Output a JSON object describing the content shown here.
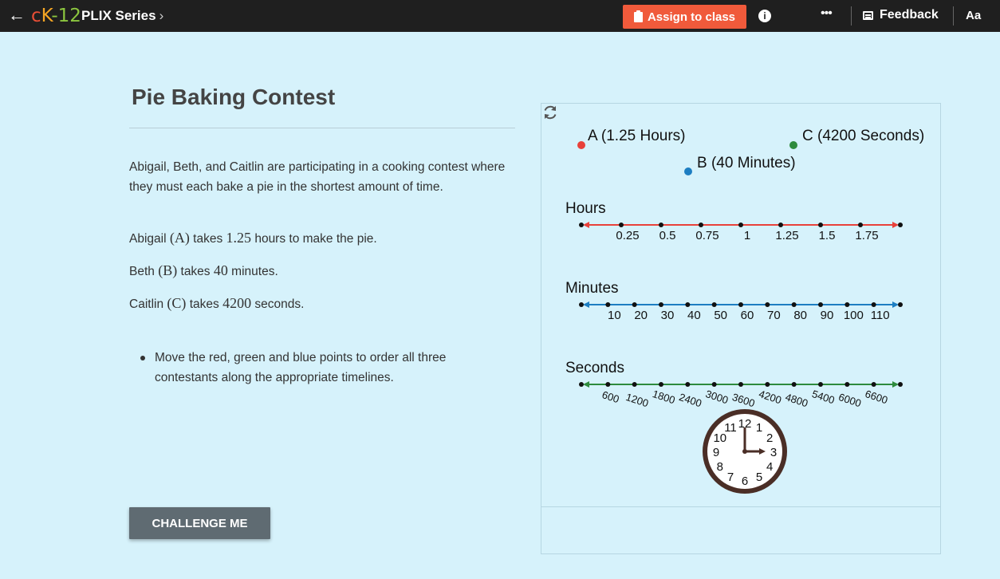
{
  "header": {
    "logo": {
      "c": "c",
      "k": "K",
      "dash": "-",
      "num": "12"
    },
    "series": "PLIX Series",
    "assign_label": "Assign to class",
    "info": "i",
    "more": "•••",
    "feedback_label": "Feedback",
    "font_size_label": "Aa"
  },
  "page": {
    "title": "Pie Baking Contest",
    "intro": "Abigail, Beth, and Caitlin are participating in a cooking contest where they must each bake a pie in the shortest amount of time.",
    "line_a": {
      "pre": "Abigail ",
      "sym": "(A)",
      "mid": " takes ",
      "num": "1.25",
      "post": " hours to make the pie."
    },
    "line_b": {
      "pre": "Beth ",
      "sym": "(B)",
      "mid": " takes ",
      "num": "40",
      "post": " minutes."
    },
    "line_c": {
      "pre": "Caitlin ",
      "sym": "(C)",
      "mid": " takes ",
      "num": "4200",
      "post": " seconds."
    },
    "instruction": "Move the red, green and blue points to order all three contestants along the appropriate timelines.",
    "challenge_label": "CHALLENGE ME"
  },
  "interactive": {
    "points": [
      {
        "label": "A (1.25 Hours)",
        "color": "#e8413a"
      },
      {
        "label": "B (40 Minutes)",
        "color": "#1d7ec2"
      },
      {
        "label": "C (4200 Seconds)",
        "color": "#2e8b3d"
      }
    ],
    "timelines": [
      {
        "name": "Hours",
        "color": "#e8413a",
        "ticks": [
          "0.25",
          "0.5",
          "0.75",
          "1",
          "1.25",
          "1.5",
          "1.75"
        ]
      },
      {
        "name": "Minutes",
        "color": "#1d7ec2",
        "ticks": [
          "10",
          "20",
          "30",
          "40",
          "50",
          "60",
          "70",
          "80",
          "90",
          "100",
          "110"
        ]
      },
      {
        "name": "Seconds",
        "color": "#2e8b3d",
        "ticks": [
          "600",
          "1200",
          "1800",
          "2400",
          "3000",
          "3600",
          "4200",
          "4800",
          "5400",
          "6000",
          "6600"
        ]
      }
    ],
    "clock": {
      "numbers": [
        "12",
        "1",
        "2",
        "3",
        "4",
        "5",
        "6",
        "7",
        "8",
        "9",
        "10",
        "11"
      ],
      "rim_color": "#4a2e26"
    }
  }
}
